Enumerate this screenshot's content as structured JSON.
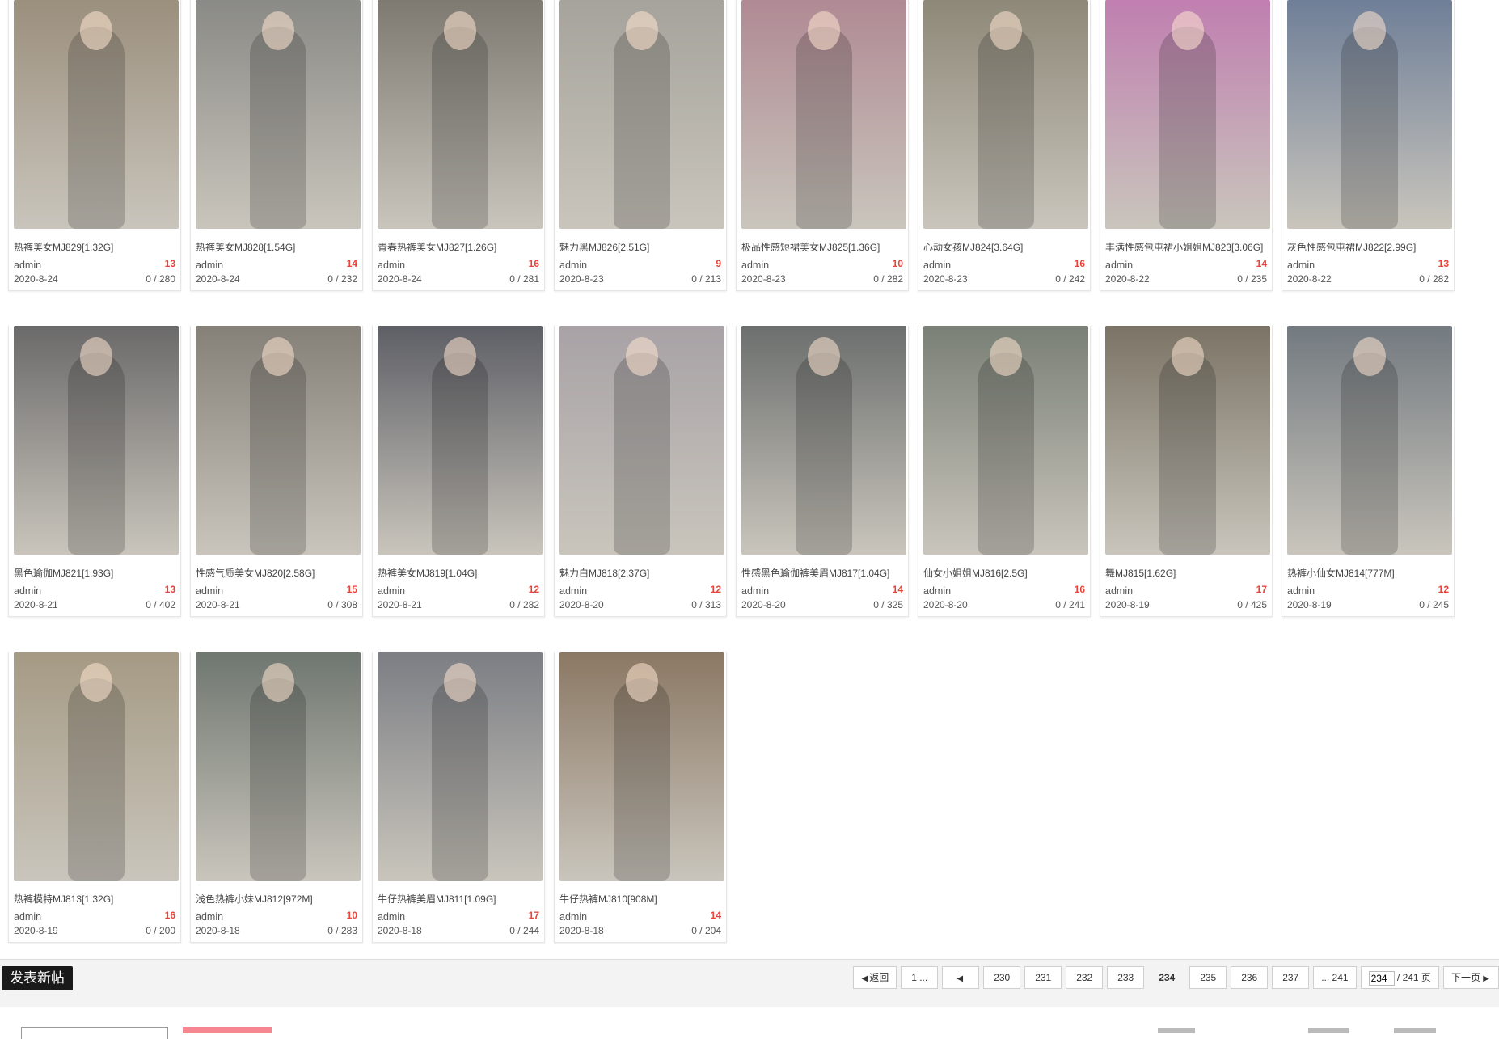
{
  "posts": [
    {
      "title": "热裤美女MJ829[1.32G]",
      "author": "admin",
      "likes": "13",
      "date": "2020-8-24",
      "stats": "0 / 280",
      "thumb": "#9b8f7d"
    },
    {
      "title": "热裤美女MJ828[1.54G]",
      "author": "admin",
      "likes": "14",
      "date": "2020-8-24",
      "stats": "0 / 232",
      "thumb": "#8a8a86"
    },
    {
      "title": "青春热裤美女MJ827[1.26G]",
      "author": "admin",
      "likes": "16",
      "date": "2020-8-24",
      "stats": "0 / 281",
      "thumb": "#7e7a72"
    },
    {
      "title": "魅力黑MJ826[2.51G]",
      "author": "admin",
      "likes": "9",
      "date": "2020-8-23",
      "stats": "0 / 213",
      "thumb": "#a6a39c"
    },
    {
      "title": "极品性感短裙美女MJ825[1.36G]",
      "author": "admin",
      "likes": "10",
      "date": "2020-8-23",
      "stats": "0 / 282",
      "thumb": "#b08a94"
    },
    {
      "title": "心动女孩MJ824[3.64G]",
      "author": "admin",
      "likes": "16",
      "date": "2020-8-23",
      "stats": "0 / 242",
      "thumb": "#8e8878"
    },
    {
      "title": "丰满性感包屯裙小姐姐MJ823[3.06G]",
      "author": "admin",
      "likes": "14",
      "date": "2020-8-22",
      "stats": "0 / 235",
      "thumb": "#c07fb0"
    },
    {
      "title": "灰色性感包屯裙MJ822[2.99G]",
      "author": "admin",
      "likes": "13",
      "date": "2020-8-22",
      "stats": "0 / 282",
      "thumb": "#6f7f98"
    },
    {
      "title": "黑色瑜伽MJ821[1.93G]",
      "author": "admin",
      "likes": "13",
      "date": "2020-8-21",
      "stats": "0 / 402",
      "thumb": "#6b6a6a"
    },
    {
      "title": "性感气质美女MJ820[2.58G]",
      "author": "admin",
      "likes": "15",
      "date": "2020-8-21",
      "stats": "0 / 308",
      "thumb": "#858078"
    },
    {
      "title": "热裤美女MJ819[1.04G]",
      "author": "admin",
      "likes": "12",
      "date": "2020-8-21",
      "stats": "0 / 282",
      "thumb": "#5e5f66"
    },
    {
      "title": "魅力白MJ818[2.37G]",
      "author": "admin",
      "likes": "12",
      "date": "2020-8-20",
      "stats": "0 / 313",
      "thumb": "#a8a2a6"
    },
    {
      "title": "性感黑色瑜伽裤美眉MJ817[1.04G]",
      "author": "admin",
      "likes": "14",
      "date": "2020-8-20",
      "stats": "0 / 325",
      "thumb": "#6c6f6e"
    },
    {
      "title": "仙女小姐姐MJ816[2.5G]",
      "author": "admin",
      "likes": "16",
      "date": "2020-8-20",
      "stats": "0 / 241",
      "thumb": "#7a8076"
    },
    {
      "title": "舞MJ815[1.62G]",
      "author": "admin",
      "likes": "17",
      "date": "2020-8-19",
      "stats": "0 / 425",
      "thumb": "#7b7466"
    },
    {
      "title": "热裤小仙女MJ814[777M]",
      "author": "admin",
      "likes": "12",
      "date": "2020-8-19",
      "stats": "0 / 245",
      "thumb": "#737a80"
    },
    {
      "title": "热裤模特MJ813[1.32G]",
      "author": "admin",
      "likes": "16",
      "date": "2020-8-19",
      "stats": "0 / 200",
      "thumb": "#a59a84"
    },
    {
      "title": "浅色热裤小妹MJ812[972M]",
      "author": "admin",
      "likes": "10",
      "date": "2020-8-18",
      "stats": "0 / 283",
      "thumb": "#6f7770"
    },
    {
      "title": "牛仔热裤美眉MJ811[1.09G]",
      "author": "admin",
      "likes": "17",
      "date": "2020-8-18",
      "stats": "0 / 244",
      "thumb": "#7c7e84"
    },
    {
      "title": "牛仔热裤MJ810[908M]",
      "author": "admin",
      "likes": "14",
      "date": "2020-8-18",
      "stats": "0 / 204",
      "thumb": "#8b7864"
    }
  ],
  "bottom_bar": {
    "new_post_label": "发表新帖",
    "back_label": "返回",
    "first_page_label": "1 ...",
    "prev_icon": "triangle-left-icon",
    "pages": [
      "230",
      "231",
      "232",
      "233",
      "234",
      "235",
      "236",
      "237"
    ],
    "current_page": "234",
    "last_page_label": "... 241",
    "jump_value": "234",
    "total_pages_label": "/ 241 页",
    "next_label": "下一页"
  }
}
